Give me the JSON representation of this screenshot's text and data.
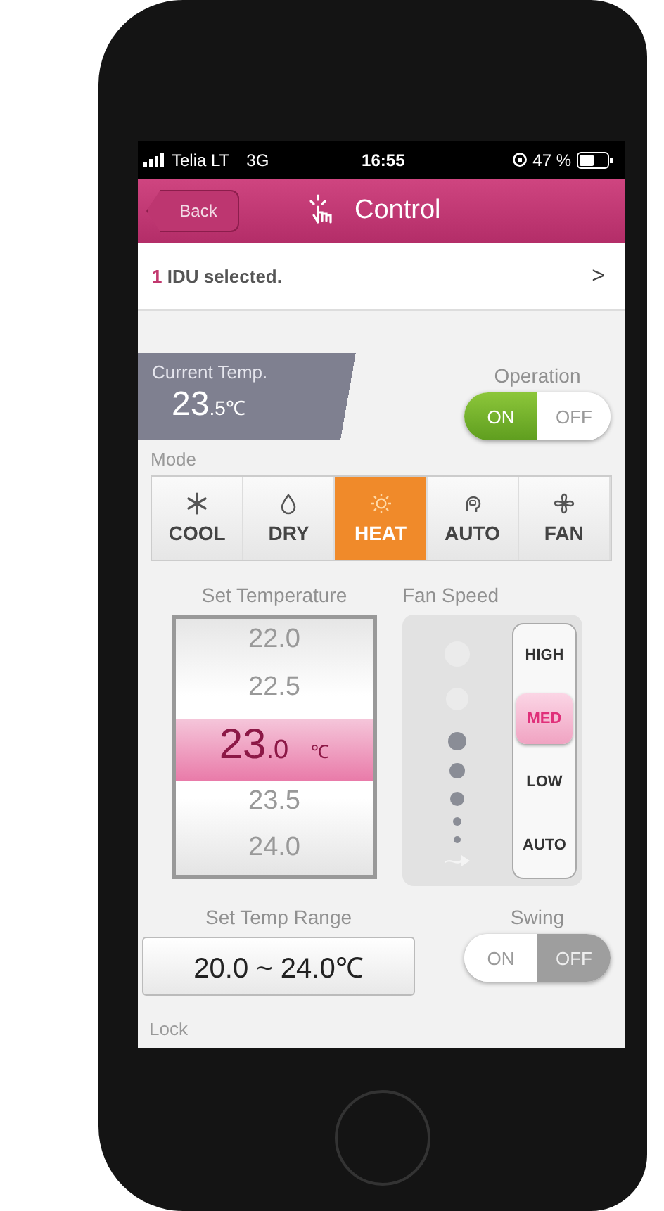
{
  "status_bar": {
    "carrier": "Telia LT",
    "network": "3G",
    "time": "16:55",
    "battery": "47 %"
  },
  "header": {
    "back": "Back",
    "title": "Control"
  },
  "selection": {
    "count": "1",
    "text": "IDU selected.",
    "chevron": ">"
  },
  "current_temp": {
    "label": "Current Temp.",
    "whole": "23",
    "fraction": ".5",
    "unit": "℃"
  },
  "operation": {
    "label": "Operation",
    "options": [
      {
        "label": "ON",
        "selected": true
      },
      {
        "label": "OFF",
        "selected": false
      }
    ]
  },
  "mode": {
    "label": "Mode",
    "options": [
      {
        "label": "COOL",
        "kind": "snow",
        "selected": false
      },
      {
        "label": "DRY",
        "kind": "drop",
        "selected": false
      },
      {
        "label": "HEAT",
        "kind": "sun",
        "selected": true
      },
      {
        "label": "AUTO",
        "kind": "ai",
        "selected": false
      },
      {
        "label": "FAN",
        "kind": "fan",
        "selected": false
      }
    ]
  },
  "set_temperature": {
    "label": "Set Temperature",
    "above": [
      "22.0",
      "22.5"
    ],
    "selected": {
      "whole": "23",
      "fraction": ".0",
      "unit": "℃"
    },
    "below": [
      "23.5",
      "24.0"
    ]
  },
  "fan_speed": {
    "label": "Fan Speed",
    "options": [
      {
        "label": "HIGH",
        "selected": false
      },
      {
        "label": "MED",
        "selected": true
      },
      {
        "label": "LOW",
        "selected": false
      },
      {
        "label": "AUTO",
        "selected": false
      }
    ]
  },
  "temp_range": {
    "label": "Set Temp Range",
    "value": "20.0 ~ 24.0℃"
  },
  "swing": {
    "label": "Swing",
    "options": [
      {
        "label": "ON",
        "selected": false
      },
      {
        "label": "OFF",
        "selected": true
      }
    ]
  },
  "lock": {
    "label": "Lock"
  }
}
